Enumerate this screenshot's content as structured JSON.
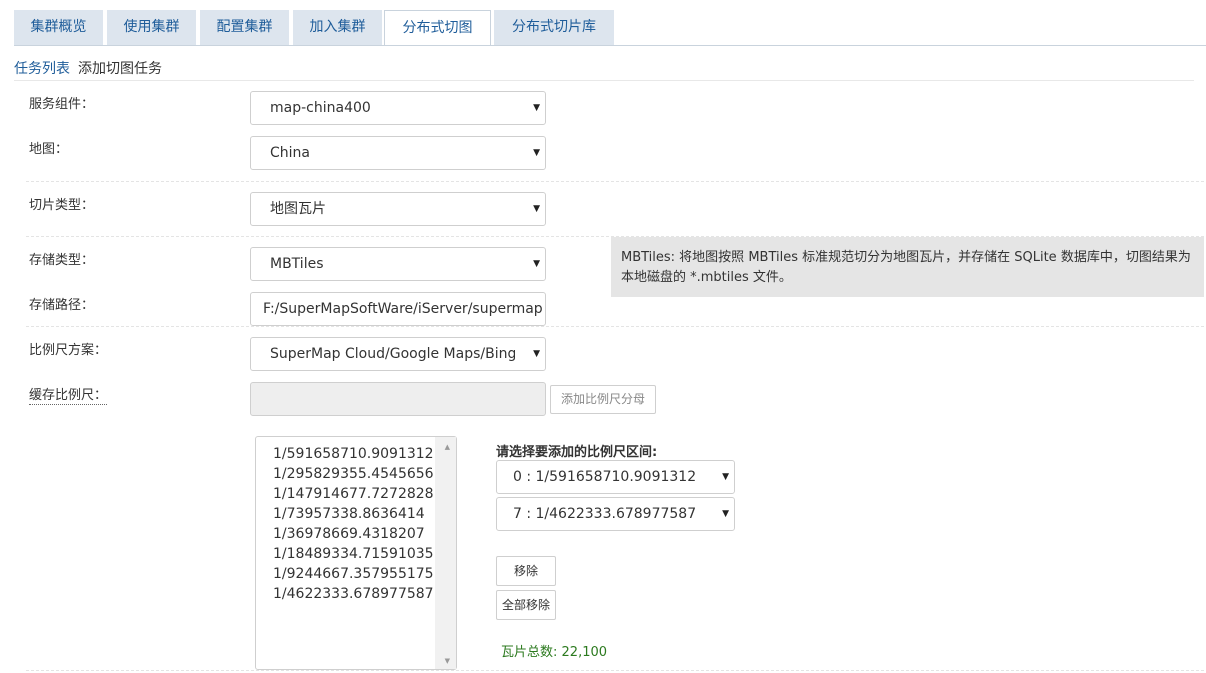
{
  "tabs": [
    {
      "label": "集群概览"
    },
    {
      "label": "使用集群"
    },
    {
      "label": "配置集群"
    },
    {
      "label": "加入集群"
    },
    {
      "label": "分布式切图"
    },
    {
      "label": "分布式切片库"
    }
  ],
  "subnav": {
    "task_list": "任务列表",
    "current": "添加切图任务"
  },
  "form": {
    "service_label": "服务组件：",
    "service_value": "map-china400",
    "map_label": "地图：",
    "map_value": "China",
    "tile_type_label": "切片类型：",
    "tile_type_value": "地图瓦片",
    "storage_type_label": "存储类型：",
    "storage_type_value": "MBTiles",
    "storage_path_label": "存储路径：",
    "storage_path_value": "F:/SuperMapSoftWare/iServer/supermap",
    "scale_scheme_label": "比例尺方案：",
    "scale_scheme_value": "SuperMap Cloud/Google Maps/Bing",
    "cache_scale_label": "缓存比例尺：",
    "add_scale_button": "添加比例尺分母"
  },
  "tip_text": "MBTiles: 将地图按照 MBTiles 标准规范切分为地图瓦片，并存储在 SQLite 数据库中，切图结果为本地磁盘的 *.mbtiles 文件。",
  "scales": [
    "1/591658710.9091312",
    "1/295829355.4545656",
    "1/147914677.7272828",
    "1/73957338.8636414",
    "1/36978669.4318207",
    "1/18489334.71591035",
    "1/9244667.357955175",
    "1/4622333.678977587"
  ],
  "range": {
    "label": "请选择要添加的比例尺区间:",
    "start": "0 : 1/591658710.9091312",
    "end": "7 : 1/4622333.678977587"
  },
  "buttons": {
    "remove": "移除",
    "remove_all": "全部移除"
  },
  "total": {
    "label": "瓦片总数:",
    "value": "22,100"
  },
  "colors": {
    "tab_bg": "#dde5ee",
    "link": "#1f5d9a",
    "total": "#2c7a1f",
    "tip_bg": "#e5e5e5"
  }
}
